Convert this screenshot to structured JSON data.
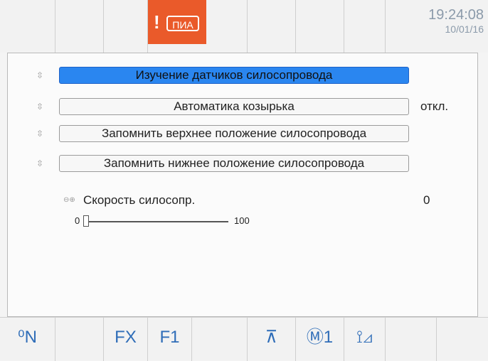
{
  "header": {
    "alarm": {
      "bang": "!",
      "icon_text": "ПИА"
    },
    "clock": {
      "time": "19:24:08",
      "date": "10/01/16"
    }
  },
  "menu": {
    "items": [
      {
        "label": "Изучение датчиков силосопровода",
        "state": "",
        "selected": true
      },
      {
        "label": "Автоматика козырька",
        "state": "откл.",
        "selected": false
      },
      {
        "label": "Запомнить верхнее положение силосопровода",
        "state": "",
        "selected": false
      },
      {
        "label": "Запомнить нижнее положение силосопровода",
        "state": "",
        "selected": false
      }
    ],
    "speed": {
      "label": "Скорость силосопр.",
      "value": "0",
      "min": "0",
      "max": "100",
      "level_fraction": 0.0
    }
  },
  "softkeys": [
    {
      "name": "neutral-key",
      "icon_text": "⁰N"
    },
    {
      "name": "blank-key-1",
      "icon_text": ""
    },
    {
      "name": "fx-key",
      "icon_text": "FX"
    },
    {
      "name": "f1-key",
      "icon_text": "F1"
    },
    {
      "name": "blank-key-2",
      "icon_text": ""
    },
    {
      "name": "header-position-key",
      "icon_text": "⊼"
    },
    {
      "name": "mode1-key",
      "icon_text": "Ⓜ1"
    },
    {
      "name": "tilt-key",
      "icon_text": "⟟⊿"
    },
    {
      "name": "blank-key-3",
      "icon_text": ""
    },
    {
      "name": "blank-key-4",
      "icon_text": ""
    }
  ],
  "colors": {
    "accent_selected": "#2a86f0",
    "alarm": "#ea5a2a",
    "clock_text": "#8b9aaa",
    "softkey_icons": "#2f6db8"
  }
}
